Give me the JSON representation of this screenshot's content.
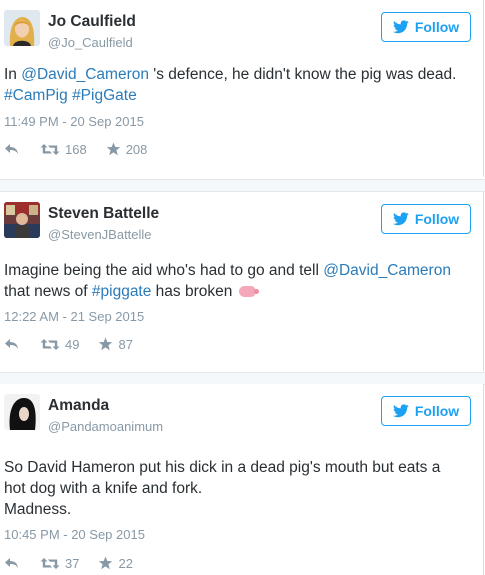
{
  "colors": {
    "link": "#2b7bb9",
    "follow": "#1da1f2",
    "meta": "#8899a6",
    "text": "#292f33"
  },
  "tweets": [
    {
      "name": "Jo Caulfield",
      "handle": "@Jo_Caulfield",
      "follow_label": "Follow",
      "text": {
        "p1": "In ",
        "mention": "@David_Cameron",
        "p2": " 's defence, he didn't know the pig was dead.",
        "tag1": "#CamPig",
        "tag2": "#PigGate"
      },
      "timestamp": "11:49 PM - 20 Sep 2015",
      "retweets": "168",
      "favorites": "208"
    },
    {
      "name": "Steven Battelle",
      "handle": "@StevenJBattelle",
      "follow_label": "Follow",
      "text": {
        "p1": "Imagine being the aid who's had to go and tell ",
        "mention": "@David_Cameron",
        "p2": "that news of ",
        "tag": "#piggate",
        "p3": " has broken"
      },
      "timestamp": "12:22 AM - 21 Sep 2015",
      "retweets": "49",
      "favorites": "87"
    },
    {
      "name": "Amanda",
      "handle": "@Pandamoanimum",
      "follow_label": "Follow",
      "text": {
        "line1": "So David Hameron put his dick in a dead pig's mouth but eats a",
        "line2": "hot dog with a knife and fork.",
        "line3": "Madness."
      },
      "timestamp": "10:45 PM - 20 Sep 2015",
      "retweets": "37",
      "favorites": "22"
    }
  ]
}
